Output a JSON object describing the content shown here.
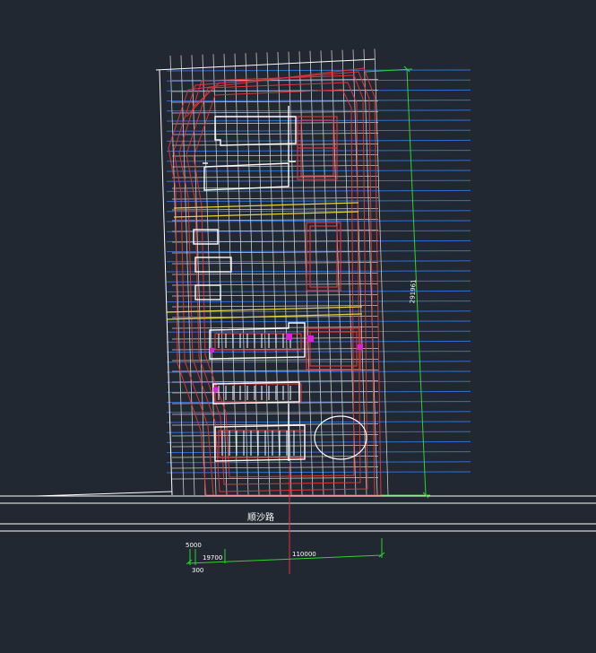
{
  "road": {
    "name": "顺沙路"
  },
  "dimensions": {
    "vertical_total": "291961",
    "horizontal_main": "110000",
    "horizontal_a": "19700",
    "horizontal_b": "5000",
    "horizontal_c": "300"
  },
  "colors": {
    "background": "#222831",
    "grid_blue": "#2e6fd6",
    "grid_white": "#d8d8d8",
    "structure_red": "#e0343a",
    "axis_yellow": "#e6d23a",
    "dimension_green": "#2bd62b",
    "marker_magenta": "#e020e0",
    "outline_white": "#ffffff"
  }
}
